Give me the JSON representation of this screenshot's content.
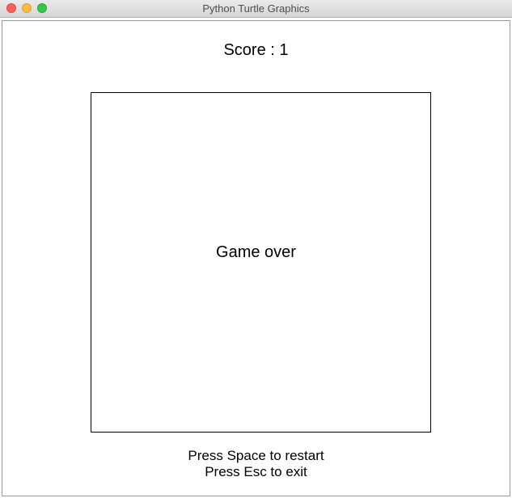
{
  "window": {
    "title": "Python Turtle Graphics"
  },
  "colors": {
    "close": "#fc605c",
    "minimize": "#fdbc40",
    "zoom": "#34c84a",
    "canvas_background": "#ffffff",
    "text": "#000000"
  },
  "game": {
    "score_text": "Score : 1",
    "status_text": "Game over",
    "instructions": [
      "Press Space to restart",
      "Press Esc to exit"
    ]
  }
}
